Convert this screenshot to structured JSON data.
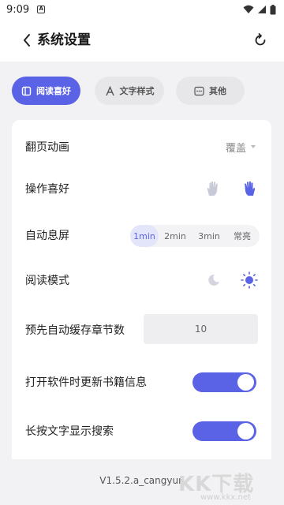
{
  "status_bar": {
    "time": "9:09",
    "app_icon_letter": "A"
  },
  "header": {
    "title": "系统设置"
  },
  "tabs": [
    {
      "label": "阅读喜好",
      "icon": "book-icon",
      "active": true
    },
    {
      "label": "文字样式",
      "icon": "letter-a-icon",
      "active": false
    },
    {
      "label": "其他",
      "icon": "more-dots-icon",
      "active": false
    }
  ],
  "settings": {
    "page_animation": {
      "label": "翻页动画",
      "value": "覆盖"
    },
    "operation_pref": {
      "label": "操作喜好",
      "options": [
        "left-hand-icon",
        "right-hand-icon"
      ],
      "selected": "right-hand-icon"
    },
    "auto_screen_off": {
      "label": "自动息屏",
      "options": [
        "1min",
        "2min",
        "3min",
        "常亮"
      ],
      "selected": "1min"
    },
    "reading_mode": {
      "label": "阅读模式",
      "options": [
        "moon-icon",
        "sun-icon"
      ],
      "selected": "sun-icon"
    },
    "precache_chapters": {
      "label": "预先自动缓存章节数",
      "value": "10"
    },
    "update_on_open": {
      "label": "打开软件时更新书籍信息",
      "enabled": true
    },
    "long_press_search": {
      "label": "长按文字显示搜索",
      "enabled": true
    }
  },
  "footer": {
    "version": "V1.5.2.a_cangyun"
  },
  "watermark": {
    "text": "KK下载",
    "url": "www.kkx.net"
  },
  "colors": {
    "accent": "#5a63e6",
    "tab_inactive_bg": "#e7e7ea",
    "page_bg": "#f2f2f4"
  }
}
